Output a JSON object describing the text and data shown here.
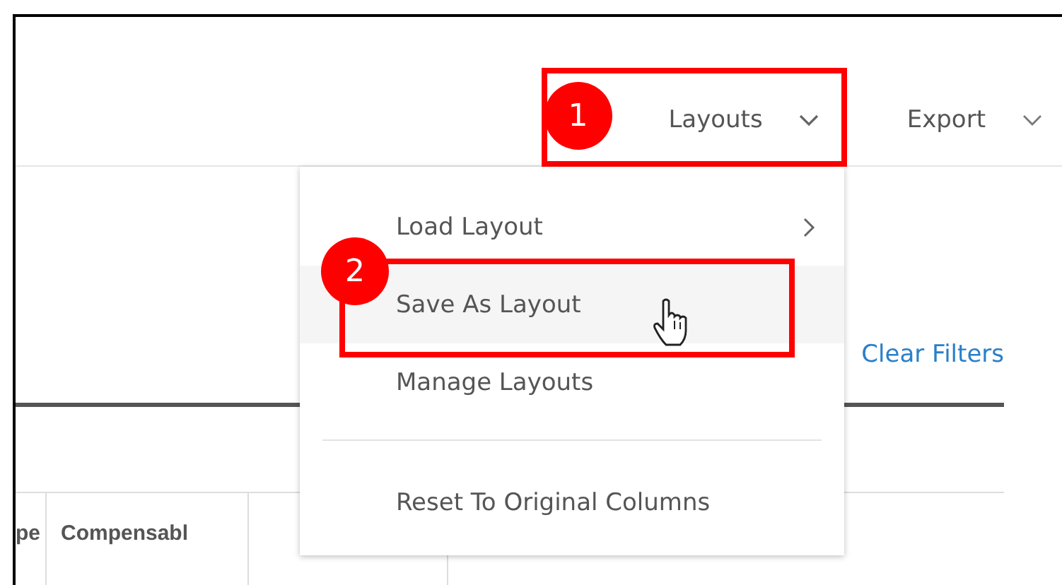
{
  "toolbar": [
    {
      "label": "Layouts",
      "expanded": true,
      "callout": "1"
    },
    {
      "label": "Export",
      "expanded": false
    }
  ],
  "menu": {
    "items": [
      {
        "kind": "submenu",
        "label": "Load Layout",
        "selected": false
      },
      {
        "kind": "item",
        "label": "Save As Layout",
        "selected": true,
        "callout": "2"
      },
      {
        "kind": "item",
        "label": "Manage Layouts",
        "selected": false
      },
      {
        "kind": "divider"
      },
      {
        "kind": "item",
        "label": "Reset To Original Columns",
        "selected": false
      }
    ]
  },
  "clear_filters": "Clear Filters",
  "table": {
    "columns": [
      "pe",
      "Compensabl",
      "",
      ""
    ]
  }
}
